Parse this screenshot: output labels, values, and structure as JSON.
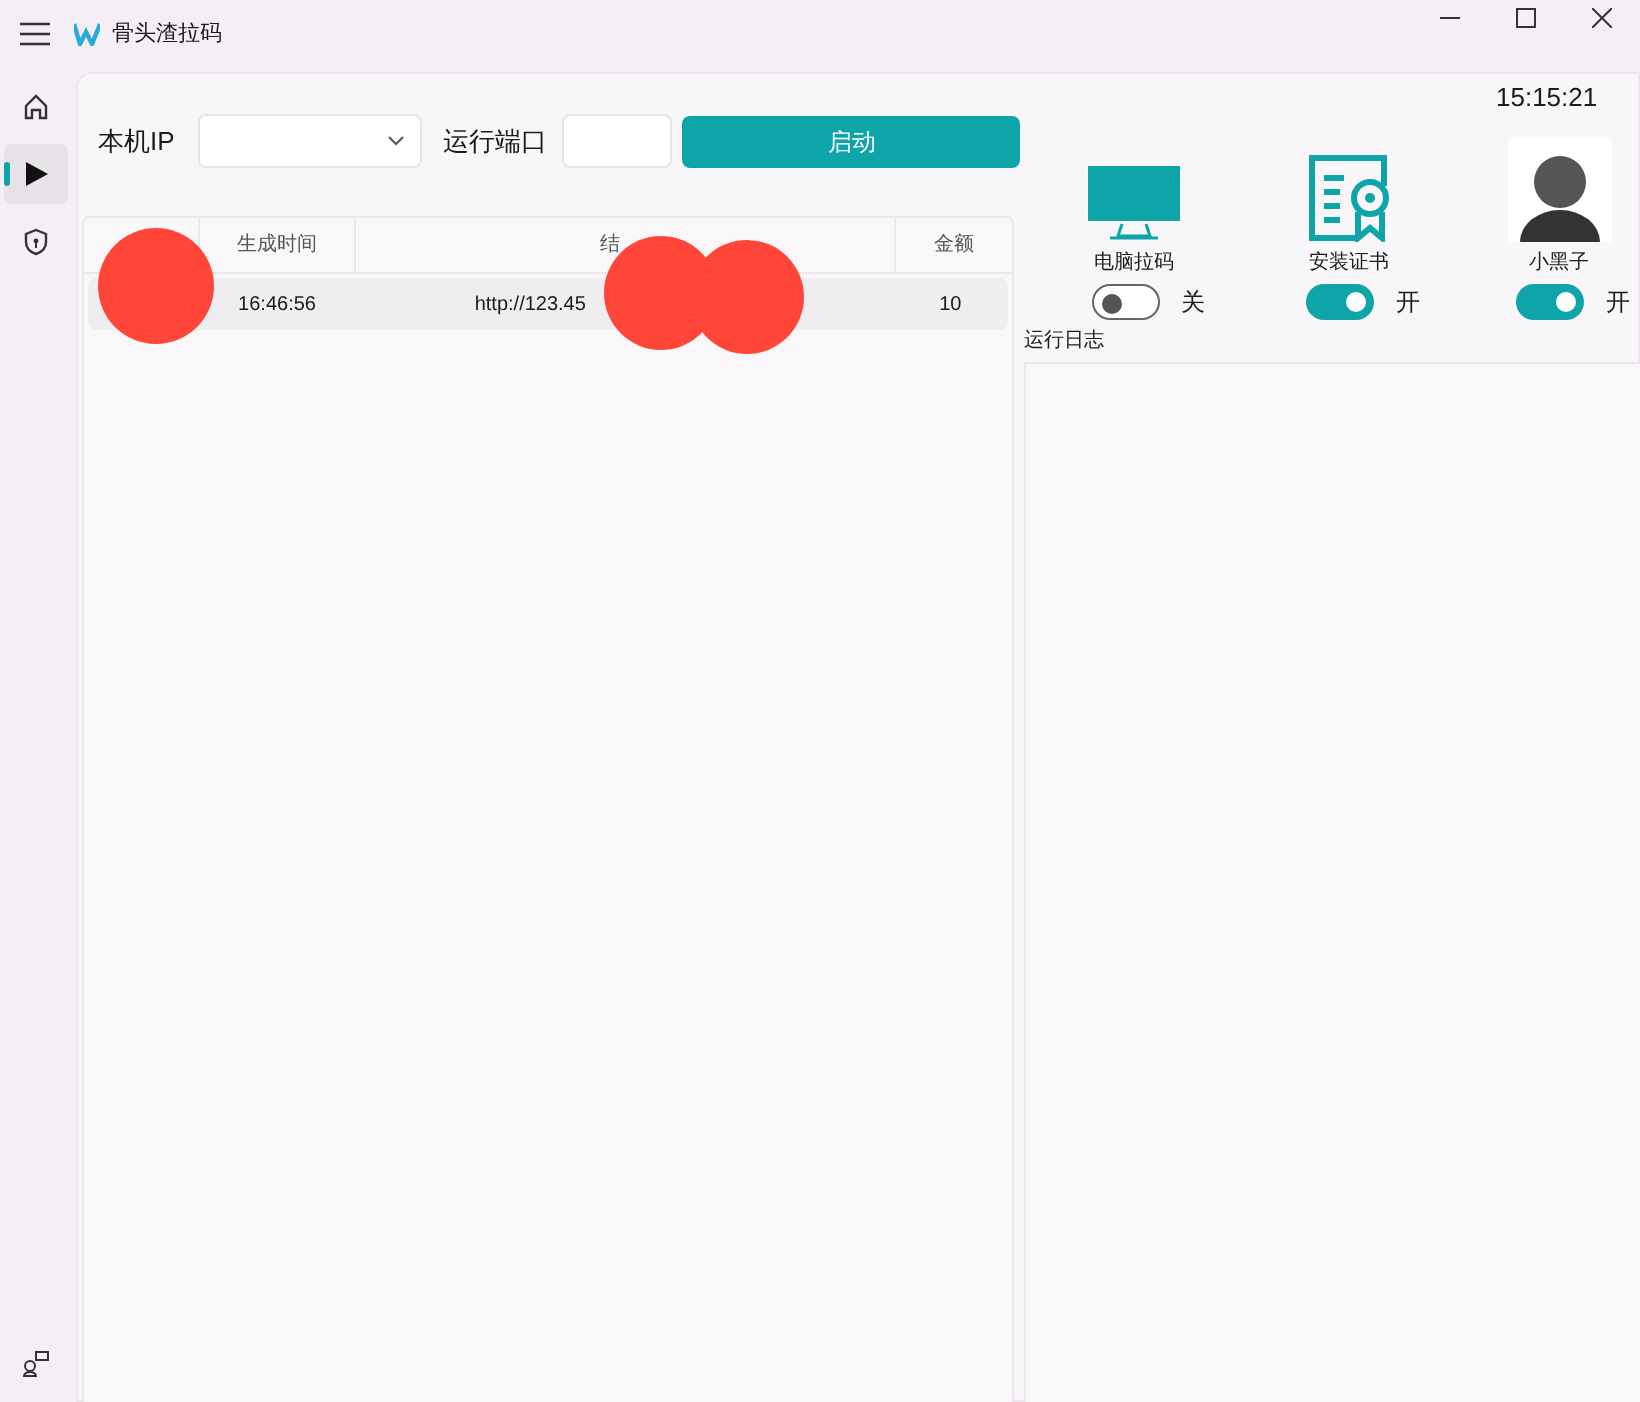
{
  "window": {
    "title": "骨头渣拉码"
  },
  "sidebar": {
    "items": [
      {
        "kind": "home",
        "selected": false
      },
      {
        "kind": "play",
        "selected": true
      },
      {
        "kind": "shield",
        "selected": false
      }
    ]
  },
  "toolbar": {
    "ip_label": "本机IP",
    "port_label": "运行端口",
    "start_button": "启动"
  },
  "table": {
    "columns": [
      "",
      "生成时间",
      "结",
      "金额"
    ],
    "rows": [
      [
        "",
        "16:46:56",
        "http://123.45",
        "10"
      ]
    ]
  },
  "clock": "15:15:21",
  "features": [
    {
      "kind": "monitor",
      "label": "电脑拉码",
      "on": false,
      "state_text": "关"
    },
    {
      "kind": "certificate",
      "label": "安装证书",
      "on": true,
      "state_text": "开"
    },
    {
      "kind": "avatar",
      "label": "小黑子",
      "on": true,
      "state_text": "开"
    }
  ],
  "log": {
    "title": "运行日志"
  }
}
